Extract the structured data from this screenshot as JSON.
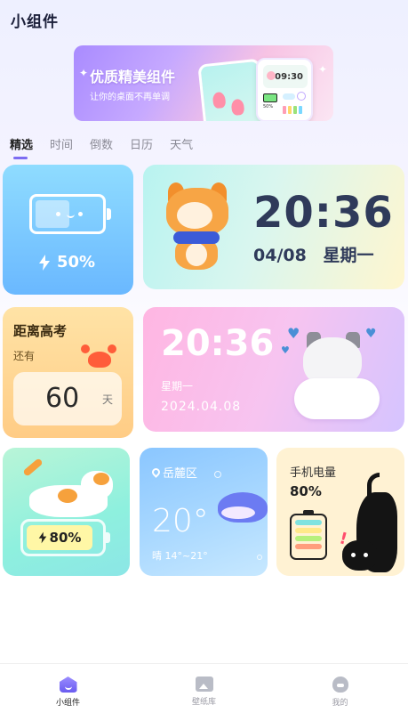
{
  "app": {
    "title": "小组件"
  },
  "banner": {
    "title": "优质精美组件",
    "subtitle": "让你的桌面不再单调",
    "mini_clock": "09:30",
    "mini_battery": "50%"
  },
  "tabs": [
    {
      "label": "精选",
      "active": true
    },
    {
      "label": "时间",
      "active": false
    },
    {
      "label": "倒数",
      "active": false
    },
    {
      "label": "日历",
      "active": false
    },
    {
      "label": "天气",
      "active": false
    }
  ],
  "widgets": {
    "battery": {
      "percent_text": "50%",
      "fill_fraction": 0.5
    },
    "shiba_clock": {
      "time": "20:36",
      "date": "04/08",
      "weekday": "星期一"
    },
    "exam_countdown": {
      "title": "距离高考",
      "subtitle": "还有",
      "days": "60",
      "unit": "天"
    },
    "cat_clock": {
      "time": "20:36",
      "weekday": "星期一",
      "date": "2024.04.08"
    },
    "pet_battery": {
      "percent_text": "80%"
    },
    "weather": {
      "location": "岳麓区",
      "temperature": "20°",
      "condition": "晴 14°~21°"
    },
    "phone_battery": {
      "title": "手机电量",
      "percent_text": "80%",
      "bar_colors": [
        "#7fe3e0",
        "#ffe98a",
        "#b6f07c",
        "#ff9e7c"
      ]
    }
  },
  "bottom_nav": [
    {
      "label": "小组件",
      "icon": "home-icon",
      "active": true
    },
    {
      "label": "壁纸库",
      "icon": "gallery-icon",
      "active": false
    },
    {
      "label": "我的",
      "icon": "profile-icon",
      "active": false
    }
  ],
  "colors": {
    "accent": "#7c6cf2"
  }
}
